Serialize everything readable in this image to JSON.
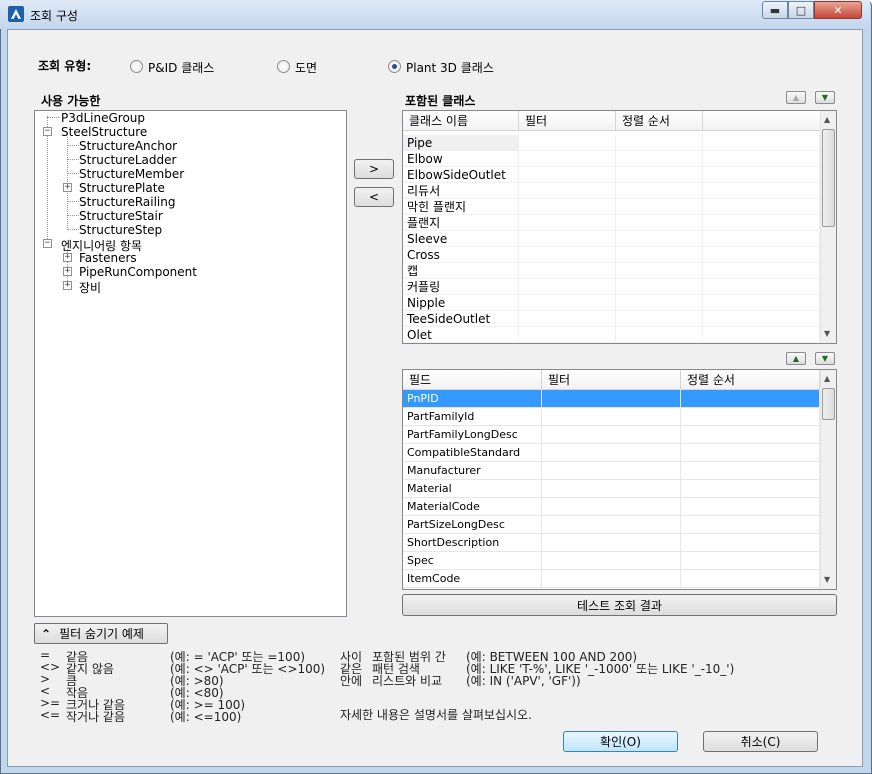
{
  "window": {
    "title": "조회 구성",
    "min_glyph": "▬",
    "max_glyph": "□",
    "close_glyph": "✕"
  },
  "query_type": {
    "label": "조회 유형:",
    "options": [
      {
        "label": "P&ID 클래스",
        "selected": false
      },
      {
        "label": "도면",
        "selected": false
      },
      {
        "label": "Plant 3D 클래스",
        "selected": true
      }
    ]
  },
  "available": {
    "label": "사용 가능한",
    "tree": [
      {
        "label": "P3dLineGroup"
      },
      {
        "label": "SteelStructure",
        "toggle": "−"
      },
      {
        "label": "StructureAnchor"
      },
      {
        "label": "StructureLadder"
      },
      {
        "label": "StructureMember"
      },
      {
        "label": "StructurePlate",
        "toggle": "+"
      },
      {
        "label": "StructureRailing"
      },
      {
        "label": "StructureStair"
      },
      {
        "label": "StructureStep"
      },
      {
        "label": "엔지니어링 항목",
        "toggle": "−"
      },
      {
        "label": "Fasteners",
        "toggle": "+"
      },
      {
        "label": "PipeRunComponent",
        "toggle": "+"
      },
      {
        "label": "장비",
        "toggle": "+"
      }
    ]
  },
  "move": {
    "add": ">",
    "remove": "<"
  },
  "included": {
    "label": "포함된 클래스",
    "columns": [
      "클래스 이름",
      "필터",
      "정렬 순서"
    ],
    "rows": [
      "Pipe",
      "Elbow",
      "ElbowSideOutlet",
      "리듀서",
      "막힌 플랜지",
      "플랜지",
      "Sleeve",
      "Cross",
      "캡",
      "커플링",
      "Nipple",
      "TeeSideOutlet",
      "Olet"
    ]
  },
  "fields": {
    "columns": [
      "필드",
      "필터",
      "정렬 순서"
    ],
    "rows": [
      "PnPID",
      "PartFamilyId",
      "PartFamilyLongDesc",
      "CompatibleStandard",
      "Manufacturer",
      "Material",
      "MaterialCode",
      "PartSizeLongDesc",
      "ShortDescription",
      "Spec",
      "ItemCode"
    ],
    "selected_row": "PnPID"
  },
  "test_button": "테스트 조회 결과",
  "filter_toggle": {
    "glyph": "⌃",
    "label": "필터 숨기기 예제"
  },
  "legend_left": [
    {
      "op": "=",
      "name": "같음",
      "ex": "(예: = 'ACP' 또는 =100)"
    },
    {
      "op": "<>",
      "name": "같지 않음",
      "ex": "(예: <> 'ACP' 또는 <>100)"
    },
    {
      "op": ">",
      "name": "큼",
      "ex": "(예: >80)"
    },
    {
      "op": "<",
      "name": "작음",
      "ex": "(예: <80)"
    },
    {
      "op": ">=",
      "name": "크거나 같음",
      "ex": "(예: >= 100)"
    },
    {
      "op": "<=",
      "name": "작거나 같음",
      "ex": "(예: <=100)"
    }
  ],
  "legend_right": [
    {
      "op": "사이",
      "name": "포함된 범위 간",
      "ex": "(예: BETWEEN 100 AND 200)"
    },
    {
      "op": "같은",
      "name": "패턴 검색",
      "ex": "(예: LIKE 'T-%', LIKE '_-1000' 또는 LIKE '_-10_')"
    },
    {
      "op": "안에",
      "name": "리스트와 비교",
      "ex": "(예: IN ('APV', 'GF'))"
    }
  ],
  "manual_note": "자세한 내용은 설명서를 살펴보십시오.",
  "ok_button": "확인(O)",
  "cancel_button": "취소(C)",
  "colors": {
    "selection": "#3399ff",
    "frame": "#c2d6ec"
  }
}
